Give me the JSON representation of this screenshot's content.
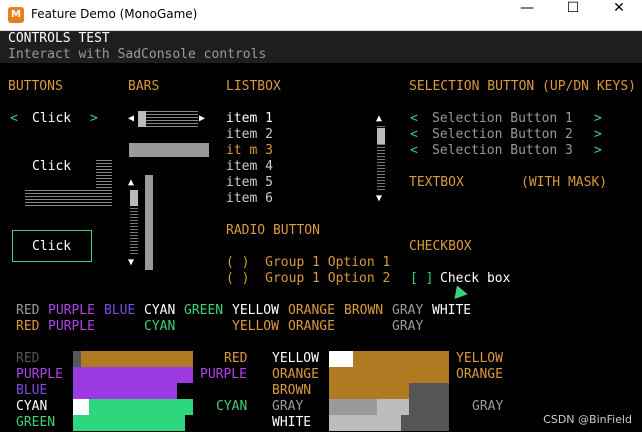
{
  "window": {
    "title": "Feature Demo (MonoGame)",
    "minimize": "—",
    "maximize": "☐",
    "close": "✕",
    "icon": "monogame-icon"
  },
  "header": {
    "title": "CONTROLS TEST",
    "subtitle": "Interact with SadConsole controls"
  },
  "buttons": {
    "label": "BUTTONS",
    "click1": "Click",
    "click2": "Click",
    "click3": "Click",
    "left_arrow": "<",
    "right_arrow": ">"
  },
  "bars": {
    "label": "BARS"
  },
  "listbox": {
    "label": "LISTBOX",
    "items": [
      "item 1",
      "item 2",
      "it m 3",
      "item 4",
      "item 5",
      "item 6"
    ],
    "up_arrow": "▲",
    "down_arrow": "▼"
  },
  "radio": {
    "label": "RADIO BUTTON",
    "options": [
      "( )  Group 1 Option 1",
      "( )  Group 1 Option 2"
    ]
  },
  "selection": {
    "label": "SELECTION BUTTON (UP/DN KEYS)",
    "items": [
      "Selection Button 1",
      "Selection Button 2",
      "Selection Button 3"
    ],
    "left": "<",
    "right": ">"
  },
  "textbox": {
    "label": "TEXTBOX",
    "mask_label": "(WITH MASK)"
  },
  "checkbox": {
    "label": "CHECKBOX",
    "box": "[ ]",
    "text": "Check box"
  },
  "palette": {
    "row1": [
      "RED",
      "PURPLE",
      "BLUE",
      "CYAN",
      "GREEN",
      "YELLOW",
      "ORANGE",
      "BROWN",
      "GRAY",
      "WHITE"
    ],
    "row2": [
      "RED",
      "PURPLE",
      "CYAN",
      "YELLOW",
      "ORANGE",
      "GRAY"
    ],
    "colors": {
      "red": "#d89a3c",
      "purple": "#b046e8",
      "blue": "#7d4ee0",
      "cyan": "#ffffff",
      "green": "#3fd07a",
      "yellow": "#ffffff",
      "orange": "#d89a3c",
      "brown": "#d89a3c",
      "gray": "#9a9a9a",
      "white": "#ffffff"
    }
  },
  "bars_section": {
    "left_labels": [
      "RED",
      "PURPLE",
      "BLUE",
      "CYAN",
      "GREEN"
    ],
    "mid_labels_left": [
      "RED",
      "PURPLE",
      "CYAN"
    ],
    "mid_labels_right": [
      "YELLOW",
      "ORANGE",
      "BROWN",
      "GRAY",
      "WHITE"
    ],
    "right_labels": [
      "YELLOW",
      "ORANGE",
      "GRAY"
    ]
  },
  "watermark": "CSDN @BinField"
}
